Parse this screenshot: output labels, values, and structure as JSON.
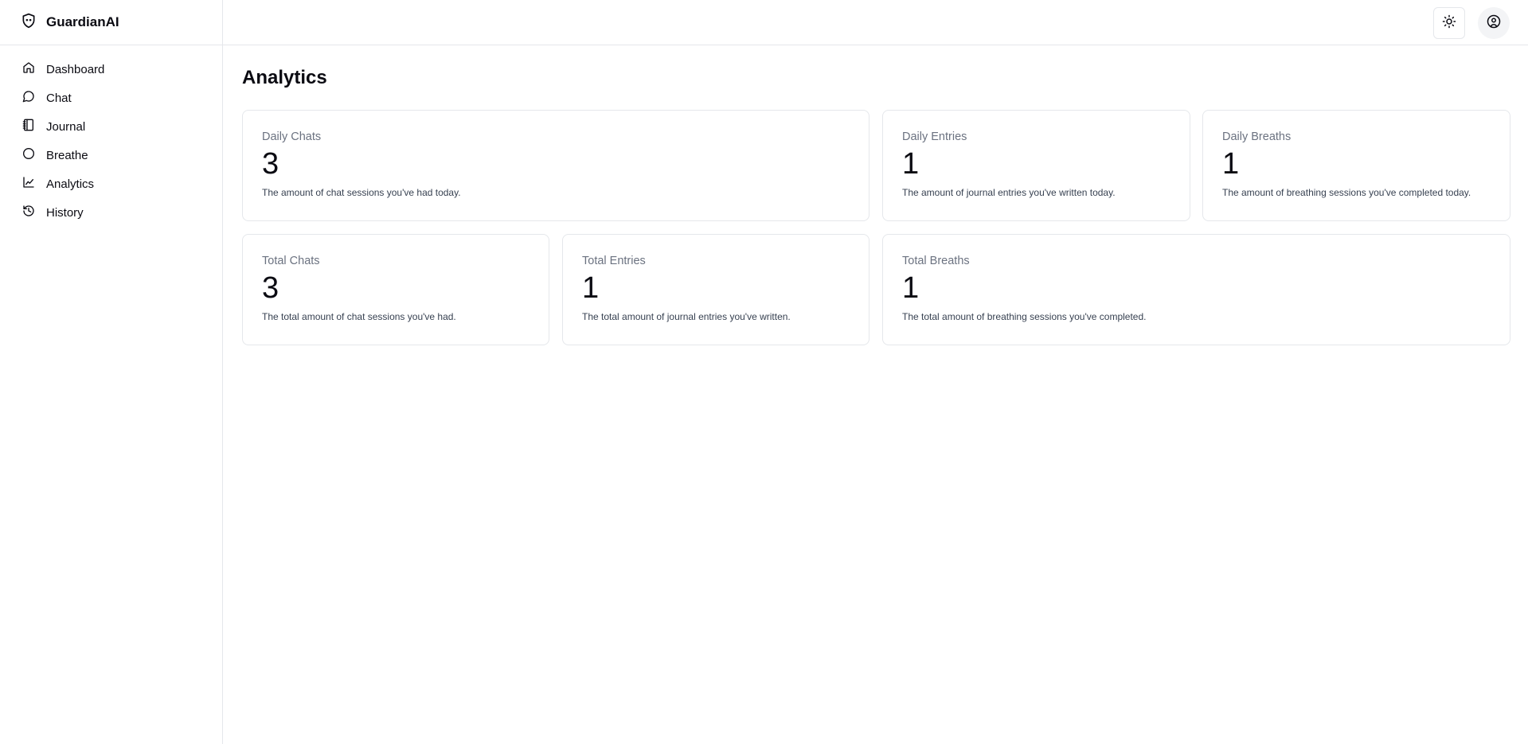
{
  "brand": {
    "name": "GuardianAI"
  },
  "sidebar": {
    "items": [
      {
        "label": "Dashboard",
        "icon": "home-icon"
      },
      {
        "label": "Chat",
        "icon": "chat-bubble-icon"
      },
      {
        "label": "Journal",
        "icon": "notebook-icon"
      },
      {
        "label": "Breathe",
        "icon": "circle-icon"
      },
      {
        "label": "Analytics",
        "icon": "line-chart-icon"
      },
      {
        "label": "History",
        "icon": "history-icon"
      }
    ]
  },
  "header": {
    "theme_icon": "sun-icon",
    "user_icon": "user-circle-icon"
  },
  "main": {
    "title": "Analytics",
    "cards": [
      {
        "label": "Daily Chats",
        "value": "3",
        "description": "The amount of chat sessions you've had today."
      },
      {
        "label": "Daily Entries",
        "value": "1",
        "description": "The amount of journal entries you've written today."
      },
      {
        "label": "Daily Breaths",
        "value": "1",
        "description": "The amount of breathing sessions you've completed today."
      },
      {
        "label": "Total Chats",
        "value": "3",
        "description": "The total amount of chat sessions you've had."
      },
      {
        "label": "Total Entries",
        "value": "1",
        "description": "The total amount of journal entries you've written."
      },
      {
        "label": "Total Breaths",
        "value": "1",
        "description": "The total amount of breathing sessions you've completed."
      }
    ]
  },
  "colors": {
    "border": "#e5e7eb",
    "text": "#0b0b12",
    "muted": "#6b7280"
  }
}
